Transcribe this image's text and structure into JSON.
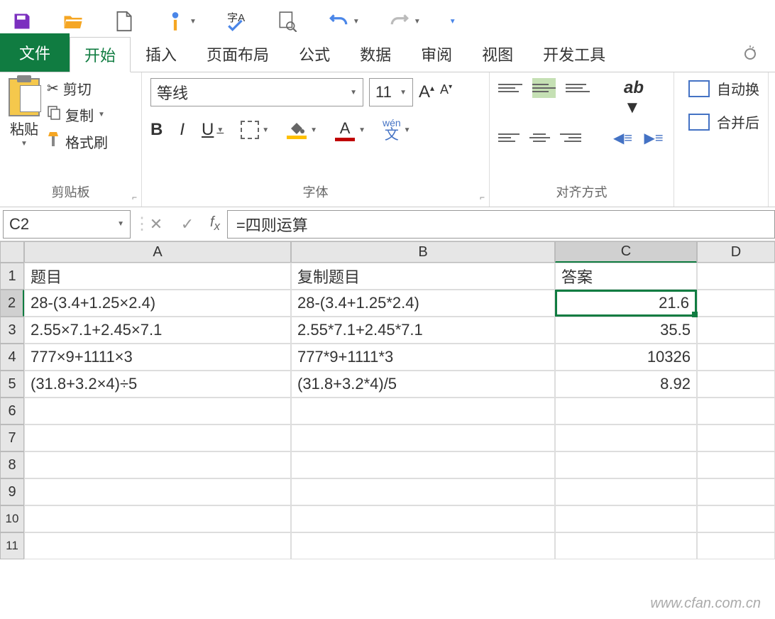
{
  "tabs": {
    "file": "文件",
    "home": "开始",
    "insert": "插入",
    "layout": "页面布局",
    "formulas": "公式",
    "data": "数据",
    "review": "审阅",
    "view": "视图",
    "developer": "开发工具"
  },
  "clipboard": {
    "paste": "粘贴",
    "cut": "剪切",
    "copy": "复制",
    "format_painter": "格式刷",
    "group_label": "剪贴板"
  },
  "font": {
    "name": "等线",
    "size": "11",
    "wen_top": "wén",
    "wen_bottom": "文",
    "group_label": "字体"
  },
  "align": {
    "group_label": "对齐方式",
    "wrap": "自动换",
    "merge": "合并后"
  },
  "namebox": "C2",
  "formula": "=四则运算",
  "cols": {
    "a": "A",
    "b": "B",
    "c": "C",
    "d": "D"
  },
  "rows": [
    "1",
    "2",
    "3",
    "4",
    "5",
    "6",
    "7",
    "8",
    "9",
    "10",
    "11"
  ],
  "headers": {
    "a": "题目",
    "b": "复制题目",
    "c": "答案"
  },
  "data_rows": [
    {
      "a": "28-(3.4+1.25×2.4)",
      "b": "28-(3.4+1.25*2.4)",
      "c": "21.6"
    },
    {
      "a": "2.55×7.1+2.45×7.1",
      "b": "2.55*7.1+2.45*7.1",
      "c": "35.5"
    },
    {
      "a": "777×9+1111×3",
      "b": "777*9+1111*3",
      "c": "10326"
    },
    {
      "a": "(31.8+3.2×4)÷5",
      "b": "(31.8+3.2*4)/5",
      "c": "8.92"
    }
  ],
  "watermark": "www.cfan.com.cn"
}
